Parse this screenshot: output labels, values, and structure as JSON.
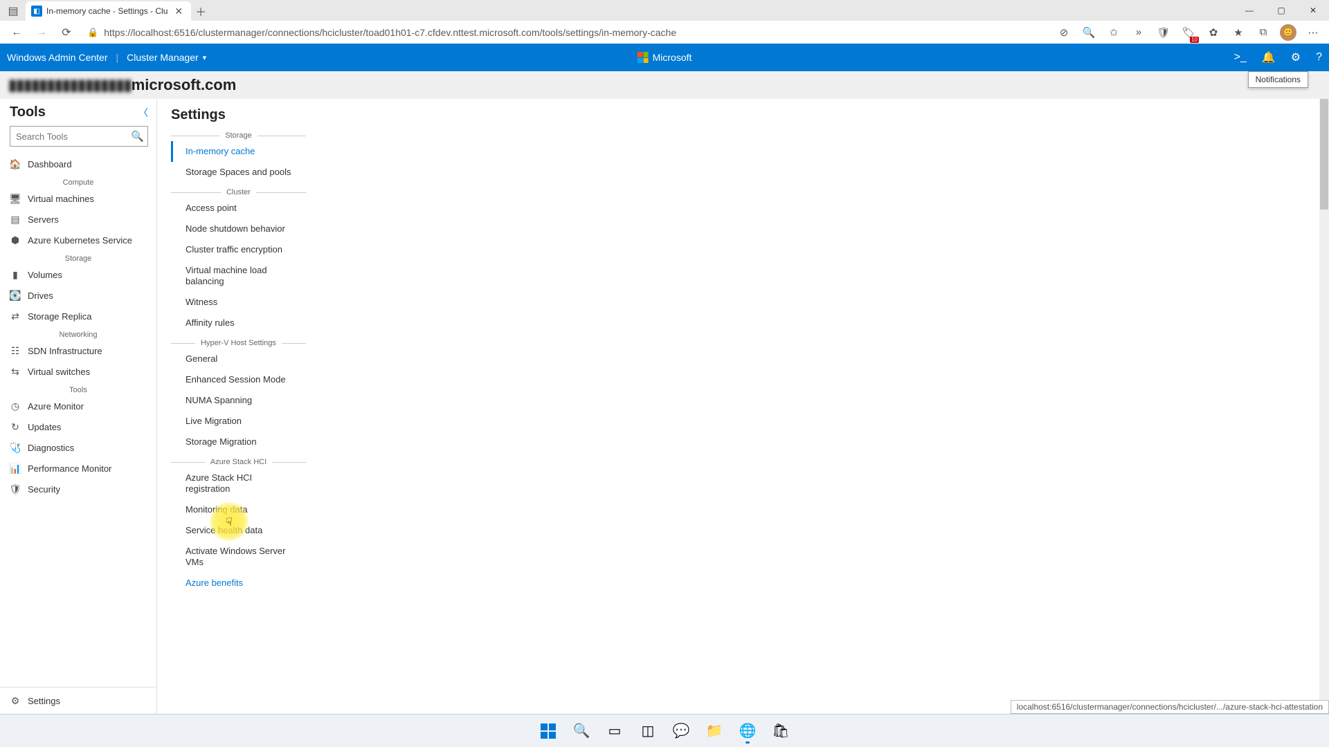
{
  "browser": {
    "tab_title": "In-memory cache - Settings - Clu",
    "url": "https://localhost:6516/clustermanager/connections/hcicluster/toad01h01-c7.cfdev.nttest.microsoft.com/tools/settings/in-memory-cache",
    "url_hint": "localhost:6516/clustermanager/connections/hcicluster/.../azure-stack-hci-attestation",
    "badge_count": "10"
  },
  "wac": {
    "title": "Windows Admin Center",
    "context": "Cluster Manager",
    "center_brand": "Microsoft",
    "notifications_label": "Notifications"
  },
  "cluster": {
    "host_blur": "▮▮▮▮▮▮▮▮▮▮▮▮▮▮▮▮",
    "host_suffix": "microsoft.com"
  },
  "tools": {
    "title": "Tools",
    "search_placeholder": "Search Tools",
    "groups": {
      "compute": "Compute",
      "storage": "Storage",
      "networking": "Networking",
      "tools": "Tools"
    },
    "items": {
      "dashboard": "Dashboard",
      "vms": "Virtual machines",
      "servers": "Servers",
      "aks": "Azure Kubernetes Service",
      "volumes": "Volumes",
      "drives": "Drives",
      "storage_replica": "Storage Replica",
      "sdn": "SDN Infrastructure",
      "vswitches": "Virtual switches",
      "azure_monitor": "Azure Monitor",
      "updates": "Updates",
      "diagnostics": "Diagnostics",
      "perf_monitor": "Performance Monitor",
      "security": "Security",
      "settings": "Settings"
    }
  },
  "settings": {
    "title": "Settings",
    "sections": {
      "storage": "Storage",
      "cluster": "Cluster",
      "hyperv": "Hyper-V Host Settings",
      "ashci": "Azure Stack HCI"
    },
    "items": {
      "in_memory_cache": "In-memory cache",
      "storage_spaces": "Storage Spaces and pools",
      "access_point": "Access point",
      "node_shutdown": "Node shutdown behavior",
      "traffic_enc": "Cluster traffic encryption",
      "vm_load_bal": "Virtual machine load balancing",
      "witness": "Witness",
      "affinity": "Affinity rules",
      "general": "General",
      "enh_session": "Enhanced Session Mode",
      "numa": "NUMA Spanning",
      "live_mig": "Live Migration",
      "storage_mig": "Storage Migration",
      "ashci_reg": "Azure Stack HCI registration",
      "monitoring": "Monitoring data",
      "service_health": "Service health data",
      "activate_ws": "Activate Windows Server VMs",
      "azure_benefits": "Azure benefits"
    }
  }
}
